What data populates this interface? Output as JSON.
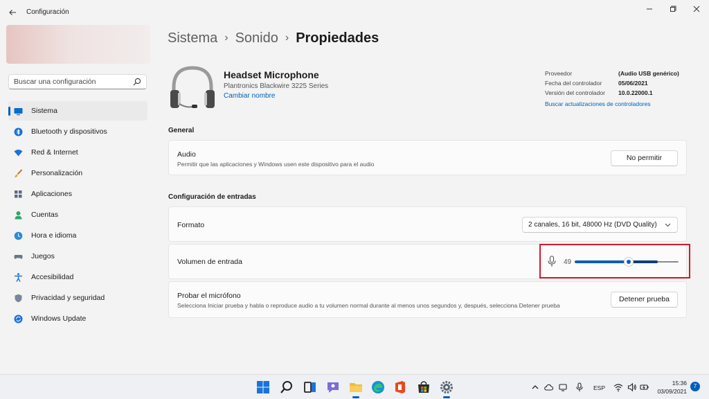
{
  "window": {
    "title": "Configuración",
    "back_icon": "back-arrow-icon",
    "controls": [
      "minimize-icon",
      "restore-icon",
      "close-icon"
    ]
  },
  "sidebar": {
    "search_placeholder": "Buscar una configuración",
    "items": [
      {
        "label": "Sistema",
        "icon": "system-icon",
        "active": true
      },
      {
        "label": "Bluetooth y dispositivos",
        "icon": "bluetooth-icon"
      },
      {
        "label": "Red & Internet",
        "icon": "network-icon"
      },
      {
        "label": "Personalización",
        "icon": "brush-icon"
      },
      {
        "label": "Aplicaciones",
        "icon": "apps-icon"
      },
      {
        "label": "Cuentas",
        "icon": "accounts-icon"
      },
      {
        "label": "Hora e idioma",
        "icon": "time-language-icon"
      },
      {
        "label": "Juegos",
        "icon": "gaming-icon"
      },
      {
        "label": "Accesibilidad",
        "icon": "accessibility-icon"
      },
      {
        "label": "Privacidad y seguridad",
        "icon": "shield-icon"
      },
      {
        "label": "Windows Update",
        "icon": "update-icon"
      }
    ]
  },
  "breadcrumb": {
    "items": [
      "Sistema",
      "Sonido"
    ],
    "current": "Propiedades",
    "separator": "›"
  },
  "device": {
    "name": "Headset Microphone",
    "model": "Plantronics Blackwire 3225 Series",
    "rename_link": "Cambiar nombre",
    "info": [
      {
        "key": "Proveedor",
        "value": "(Audio USB genérico)"
      },
      {
        "key": "Fecha del controlador",
        "value": "05/06/2021"
      },
      {
        "key": "Versión del controlador",
        "value": "10.0.22000.1"
      }
    ],
    "driver_link": "Buscar actualizaciones de controladores"
  },
  "general": {
    "title": "General",
    "audio": {
      "title": "Audio",
      "description": "Permitir que las aplicaciones y Windows usen este dispositivo para el audio",
      "button": "No permitir"
    }
  },
  "input_settings": {
    "title": "Configuración de entradas",
    "format": {
      "label": "Formato",
      "selected": "2 canales, 16 bit, 48000 Hz (DVD Quality)"
    },
    "volume": {
      "label": "Volumen de entrada",
      "value": "49",
      "level": 0.49,
      "peak_level": 0.8
    },
    "test": {
      "title": "Probar el micrófono",
      "description": "Selecciona Iniciar prueba y habla o reproduce audio a tu volumen normal durante al menos unos segundos y, después, selecciona Detener prueba",
      "button": "Detener prueba"
    }
  },
  "taskbar": {
    "apps": [
      "start-icon",
      "search-icon",
      "task-view-icon",
      "chat-icon",
      "file-explorer-icon",
      "edge-icon",
      "office-icon",
      "store-icon",
      "settings-icon"
    ],
    "tray": {
      "language": "ESP",
      "time": "15:36",
      "date": "03/09/2021",
      "notifications": "7"
    }
  },
  "colors": {
    "accent": "#005fb8",
    "highlight_box": "#d1192b",
    "background": "#f3f3f3",
    "card": "#fbfbfb"
  }
}
